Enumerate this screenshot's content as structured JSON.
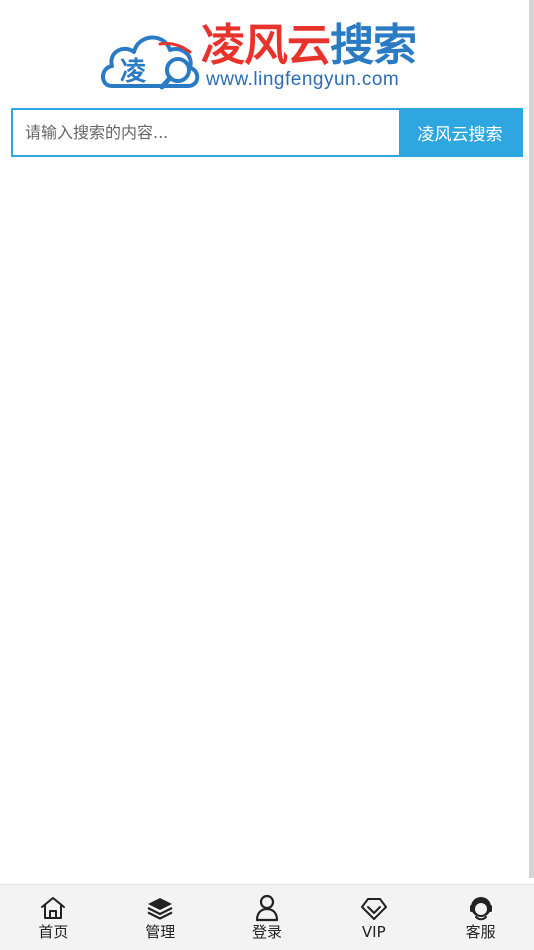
{
  "logo": {
    "title_red": "凌风云",
    "title_blue": "搜索",
    "badge_char": "凌",
    "url": "www.lingfengyun.com"
  },
  "search": {
    "placeholder": "请输入搜索的内容...",
    "value": "",
    "button_label": "凌风云搜索"
  },
  "nav": {
    "items": [
      {
        "label": "首页",
        "icon": "home-icon"
      },
      {
        "label": "管理",
        "icon": "layers-icon"
      },
      {
        "label": "登录",
        "icon": "user-icon"
      },
      {
        "label": "VIP",
        "icon": "diamond-icon"
      },
      {
        "label": "客服",
        "icon": "headset-icon"
      }
    ]
  },
  "colors": {
    "accent": "#2fa6e0",
    "logo_red": "#e8332d",
    "logo_blue": "#2a7bc4"
  }
}
